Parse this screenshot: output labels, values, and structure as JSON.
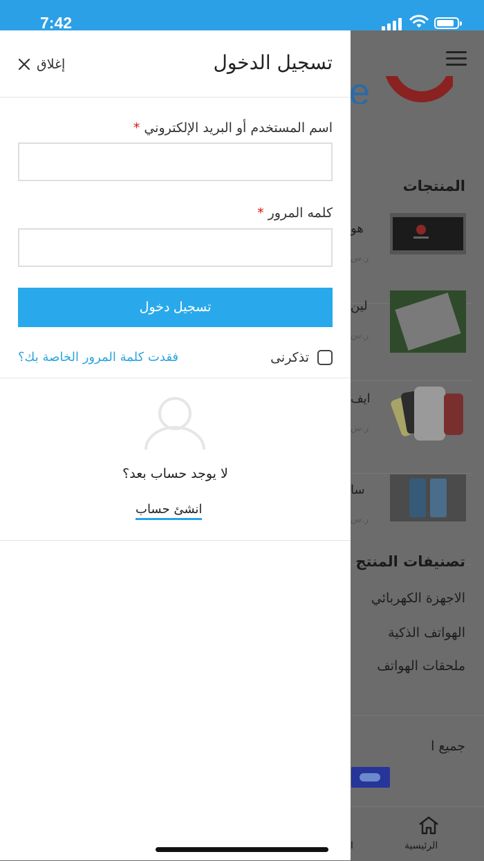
{
  "status_bar": {
    "time": "7:42",
    "icons": [
      "signal-icon",
      "wifi-icon",
      "battery-icon"
    ]
  },
  "drawer": {
    "title": "تسجيل الدخول",
    "close_label": "إغلاق",
    "username_label": "اسم المستخدم أو البريد الإلكتروني",
    "username_value": "",
    "password_label": "كلمه المرور",
    "password_value": "",
    "required_mark": "*",
    "submit_label": "تسجيل دخول",
    "remember_label": "تذكرنى",
    "remember_checked": false,
    "forgot_label": "فقدت كلمة المرور الخاصة بك؟",
    "no_account_text": "لا يوجد حساب بعد؟",
    "create_account_label": "انشئ حساب"
  },
  "background": {
    "products_heading": "المنتجات",
    "products": [
      {
        "title": "هو",
        "price": "ر.س"
      },
      {
        "title": "لين",
        "price": "ر.س"
      },
      {
        "title": "ايف",
        "price": "ر.س"
      },
      {
        "title": "سا",
        "price": "ر.س"
      }
    ],
    "categories_heading": "تصنيفات المنتج",
    "categories": [
      "الاجهزة الكهربائي",
      "الهواتف الذكية",
      "ملحقات الهواتف"
    ],
    "all_label": "جميع ا",
    "tab_home_label": "الرئيسية",
    "tab_partial": "ا"
  },
  "colors": {
    "accent": "#29a9ec",
    "required": "#dd1111",
    "link": "#2ba4dc"
  }
}
